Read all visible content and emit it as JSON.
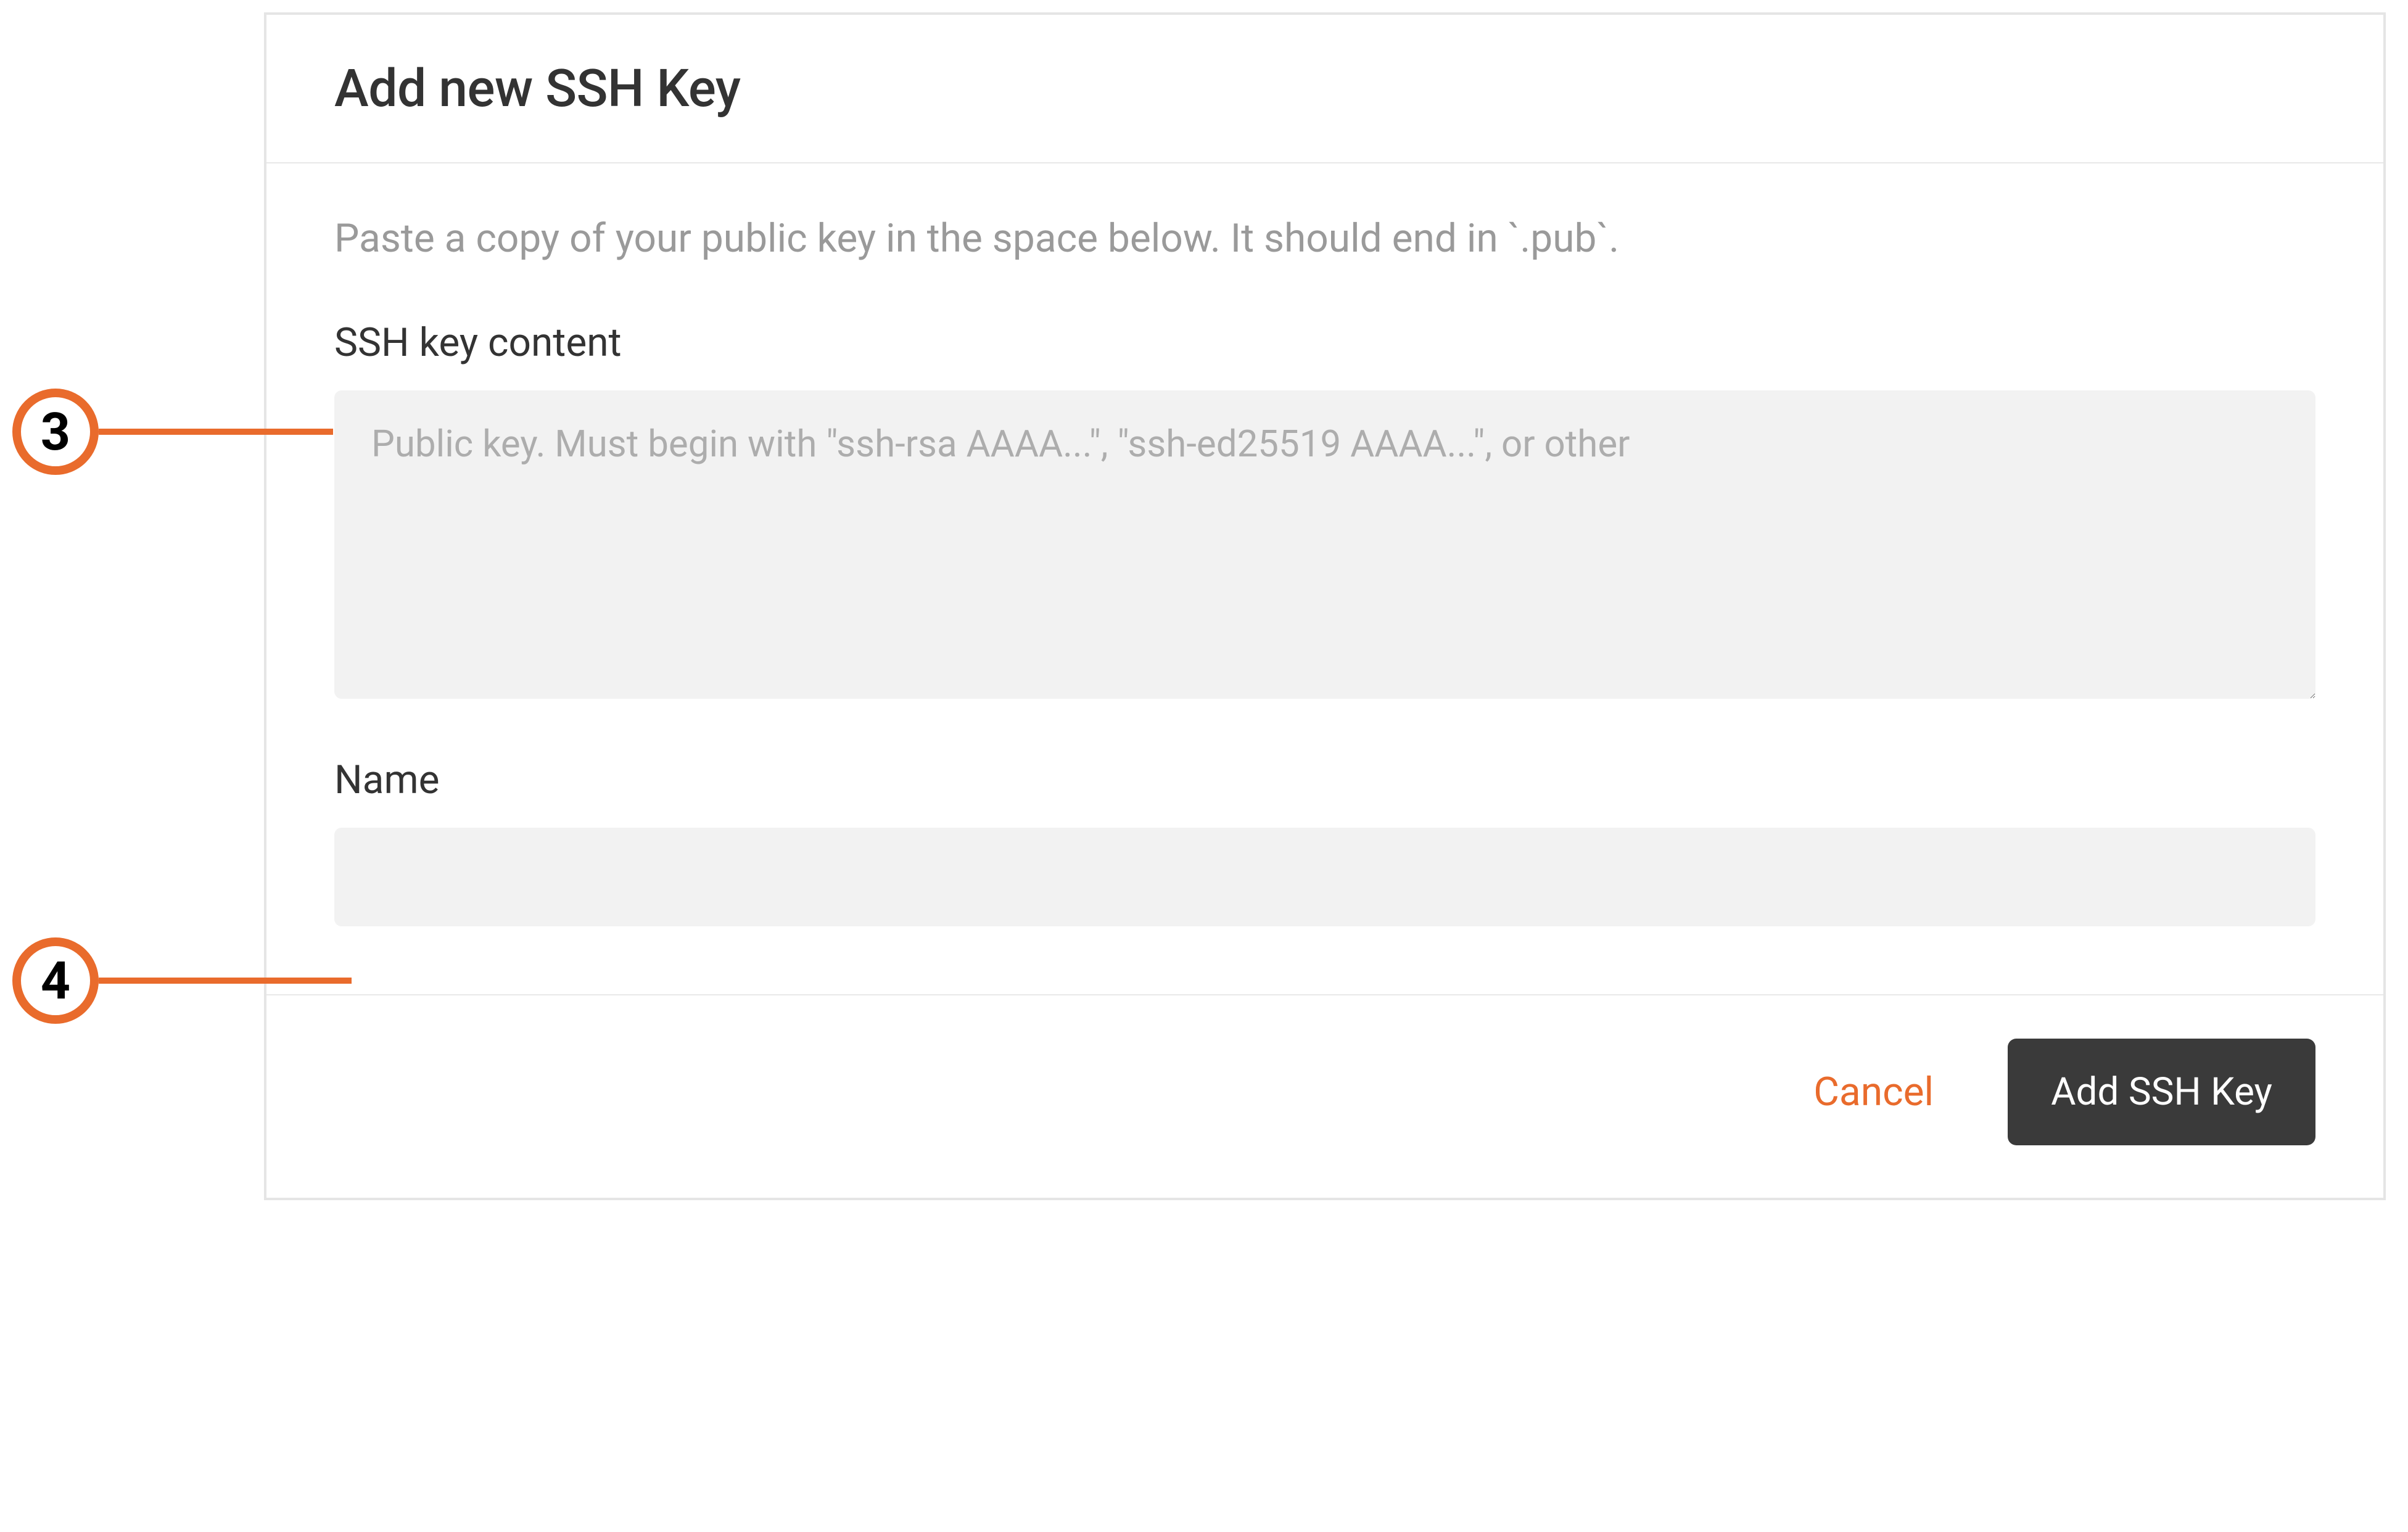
{
  "dialog": {
    "title": "Add new SSH Key",
    "instruction": "Paste a copy of your public key in the space below. It should end in `.pub`.",
    "fields": {
      "ssh_content": {
        "label": "SSH key content",
        "placeholder": "Public key. Must begin with \"ssh-rsa AAAA...\", \"ssh-ed25519 AAAA...\", or other",
        "value": ""
      },
      "name": {
        "label": "Name",
        "value": ""
      }
    },
    "buttons": {
      "cancel": "Cancel",
      "submit": "Add SSH Key"
    }
  },
  "callouts": {
    "step3": "3",
    "step4": "4"
  }
}
